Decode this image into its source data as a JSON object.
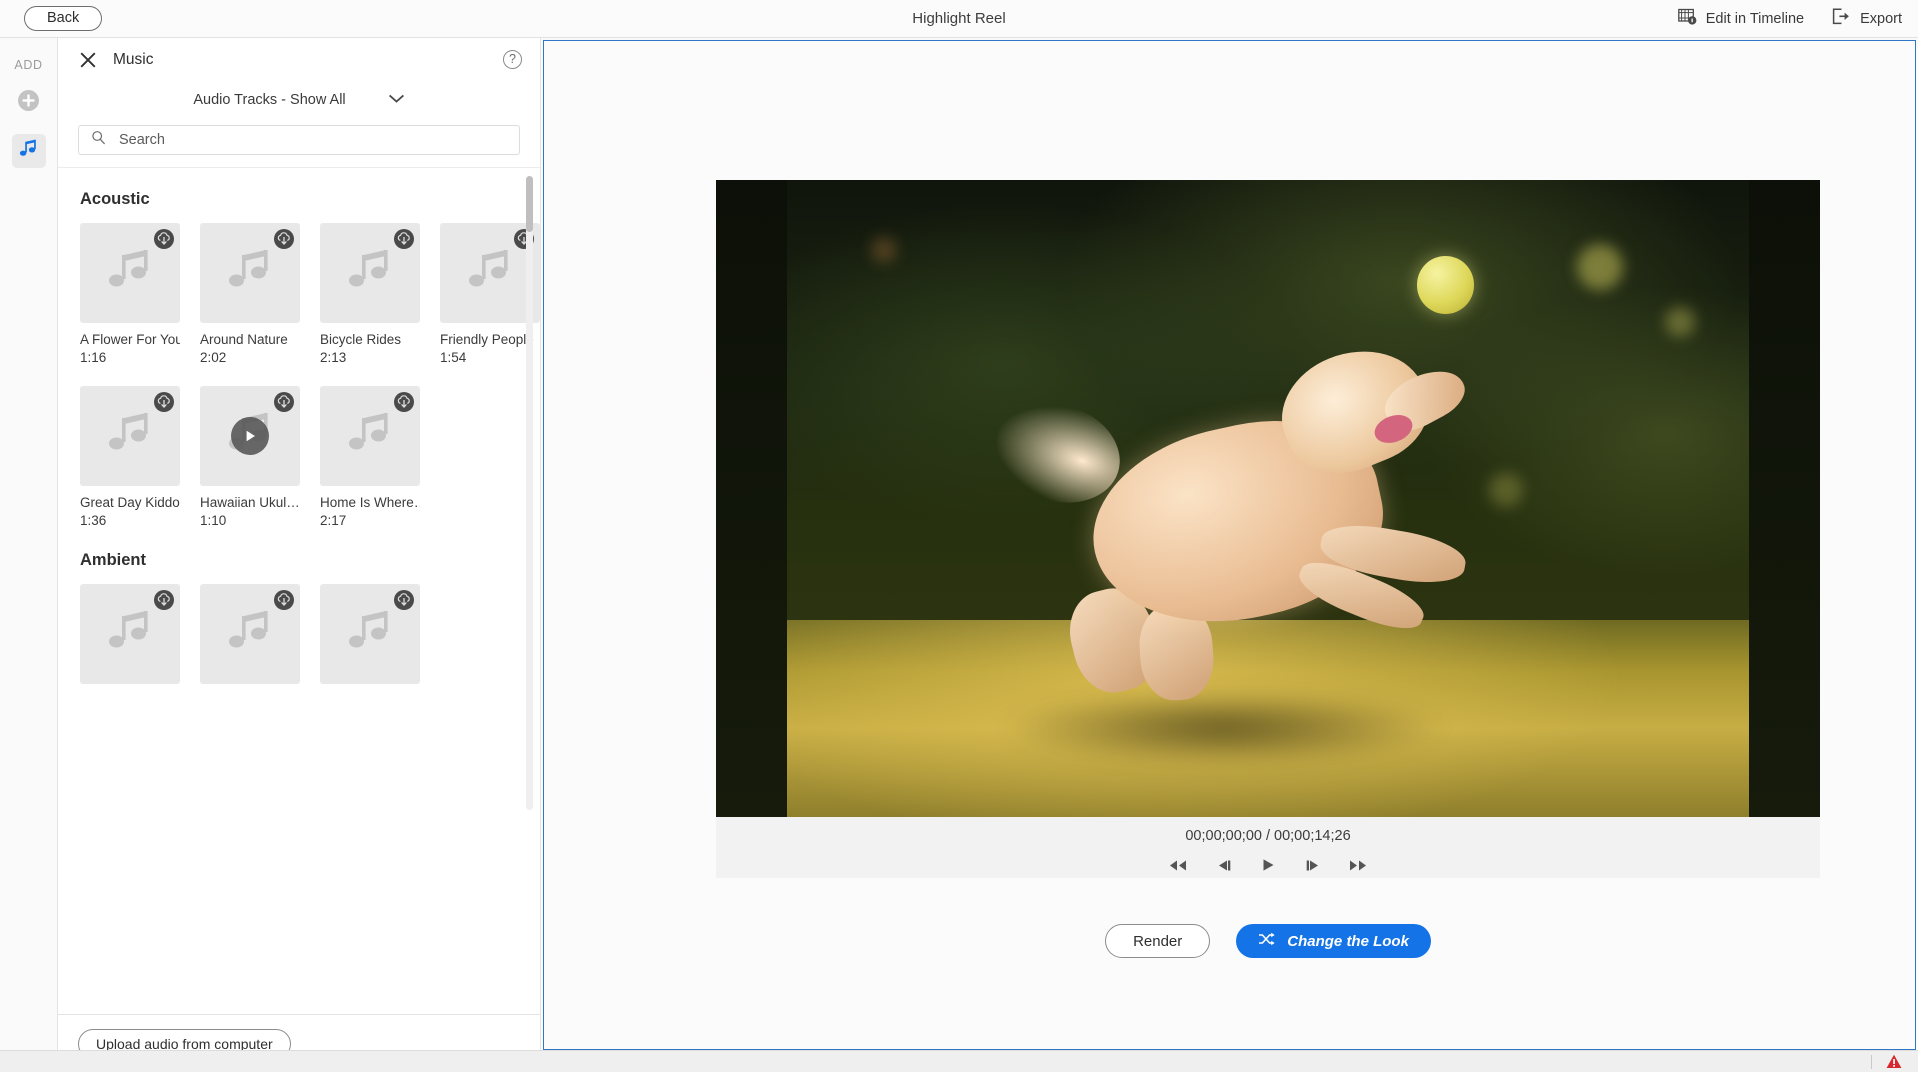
{
  "topbar": {
    "back_label": "Back",
    "title": "Highlight Reel",
    "edit_timeline_label": "Edit in Timeline",
    "export_label": "Export"
  },
  "rail": {
    "add_label": "ADD",
    "items": [
      {
        "name": "add-media",
        "icon": "plus-circle-icon",
        "selected": false
      },
      {
        "name": "music",
        "icon": "music-note-icon",
        "selected": true
      }
    ]
  },
  "panel": {
    "title": "Music",
    "close_icon": "close-icon",
    "help_icon": "help-icon",
    "filter_label": "Audio Tracks - Show All",
    "filter_chevron": "chevron-down-icon",
    "search_placeholder": "Search",
    "search_value": "",
    "search_icon": "search-icon",
    "upload_label": "Upload audio from computer",
    "sections": [
      {
        "title": "Acoustic",
        "tracks": [
          {
            "name": "A Flower For You",
            "duration": "1:16",
            "badge": "download-icon",
            "playing": false
          },
          {
            "name": "Around Nature",
            "duration": "2:02",
            "badge": "download-icon",
            "playing": false
          },
          {
            "name": "Bicycle Rides",
            "duration": "2:13",
            "badge": "download-icon",
            "playing": false
          },
          {
            "name": "Friendly People",
            "duration": "1:54",
            "badge": "download-icon",
            "playing": false
          },
          {
            "name": "Great Day Kiddo",
            "duration": "1:36",
            "badge": "download-icon",
            "playing": false
          },
          {
            "name": "Hawaiian Ukul…",
            "duration": "1:10",
            "badge": "download-icon",
            "playing": true
          },
          {
            "name": "Home Is Where…",
            "duration": "2:17",
            "badge": "download-icon",
            "playing": false
          }
        ]
      },
      {
        "title": "Ambient",
        "tracks": [
          {
            "name": "",
            "duration": "",
            "badge": "download-icon",
            "playing": false
          },
          {
            "name": "",
            "duration": "",
            "badge": "download-icon",
            "playing": false
          },
          {
            "name": "",
            "duration": "",
            "badge": "download-icon",
            "playing": false
          }
        ]
      }
    ]
  },
  "preview": {
    "current_time": "00;00;00;00",
    "total_time": "00;00;14;26",
    "timecode": "00;00;00;00 / 00;00;14;26",
    "transport": [
      {
        "name": "rewind-button",
        "icon": "rewind-icon"
      },
      {
        "name": "step-back-button",
        "icon": "step-back-icon"
      },
      {
        "name": "play-button",
        "icon": "play-icon"
      },
      {
        "name": "step-forward-button",
        "icon": "step-forward-icon"
      },
      {
        "name": "fast-forward-button",
        "icon": "fast-forward-icon"
      }
    ],
    "render_label": "Render",
    "change_look_label": "Change the Look",
    "change_look_icon": "shuffle-icon"
  },
  "statusbar": {
    "warning_icon": "warning-triangle-icon"
  },
  "colors": {
    "accent_blue": "#1473e6",
    "panel_border_blue": "#2f76c7",
    "warning_red": "#d7282f",
    "thumb_gray": "#e8e8e8",
    "badge_gray": "#4a4a4a"
  }
}
